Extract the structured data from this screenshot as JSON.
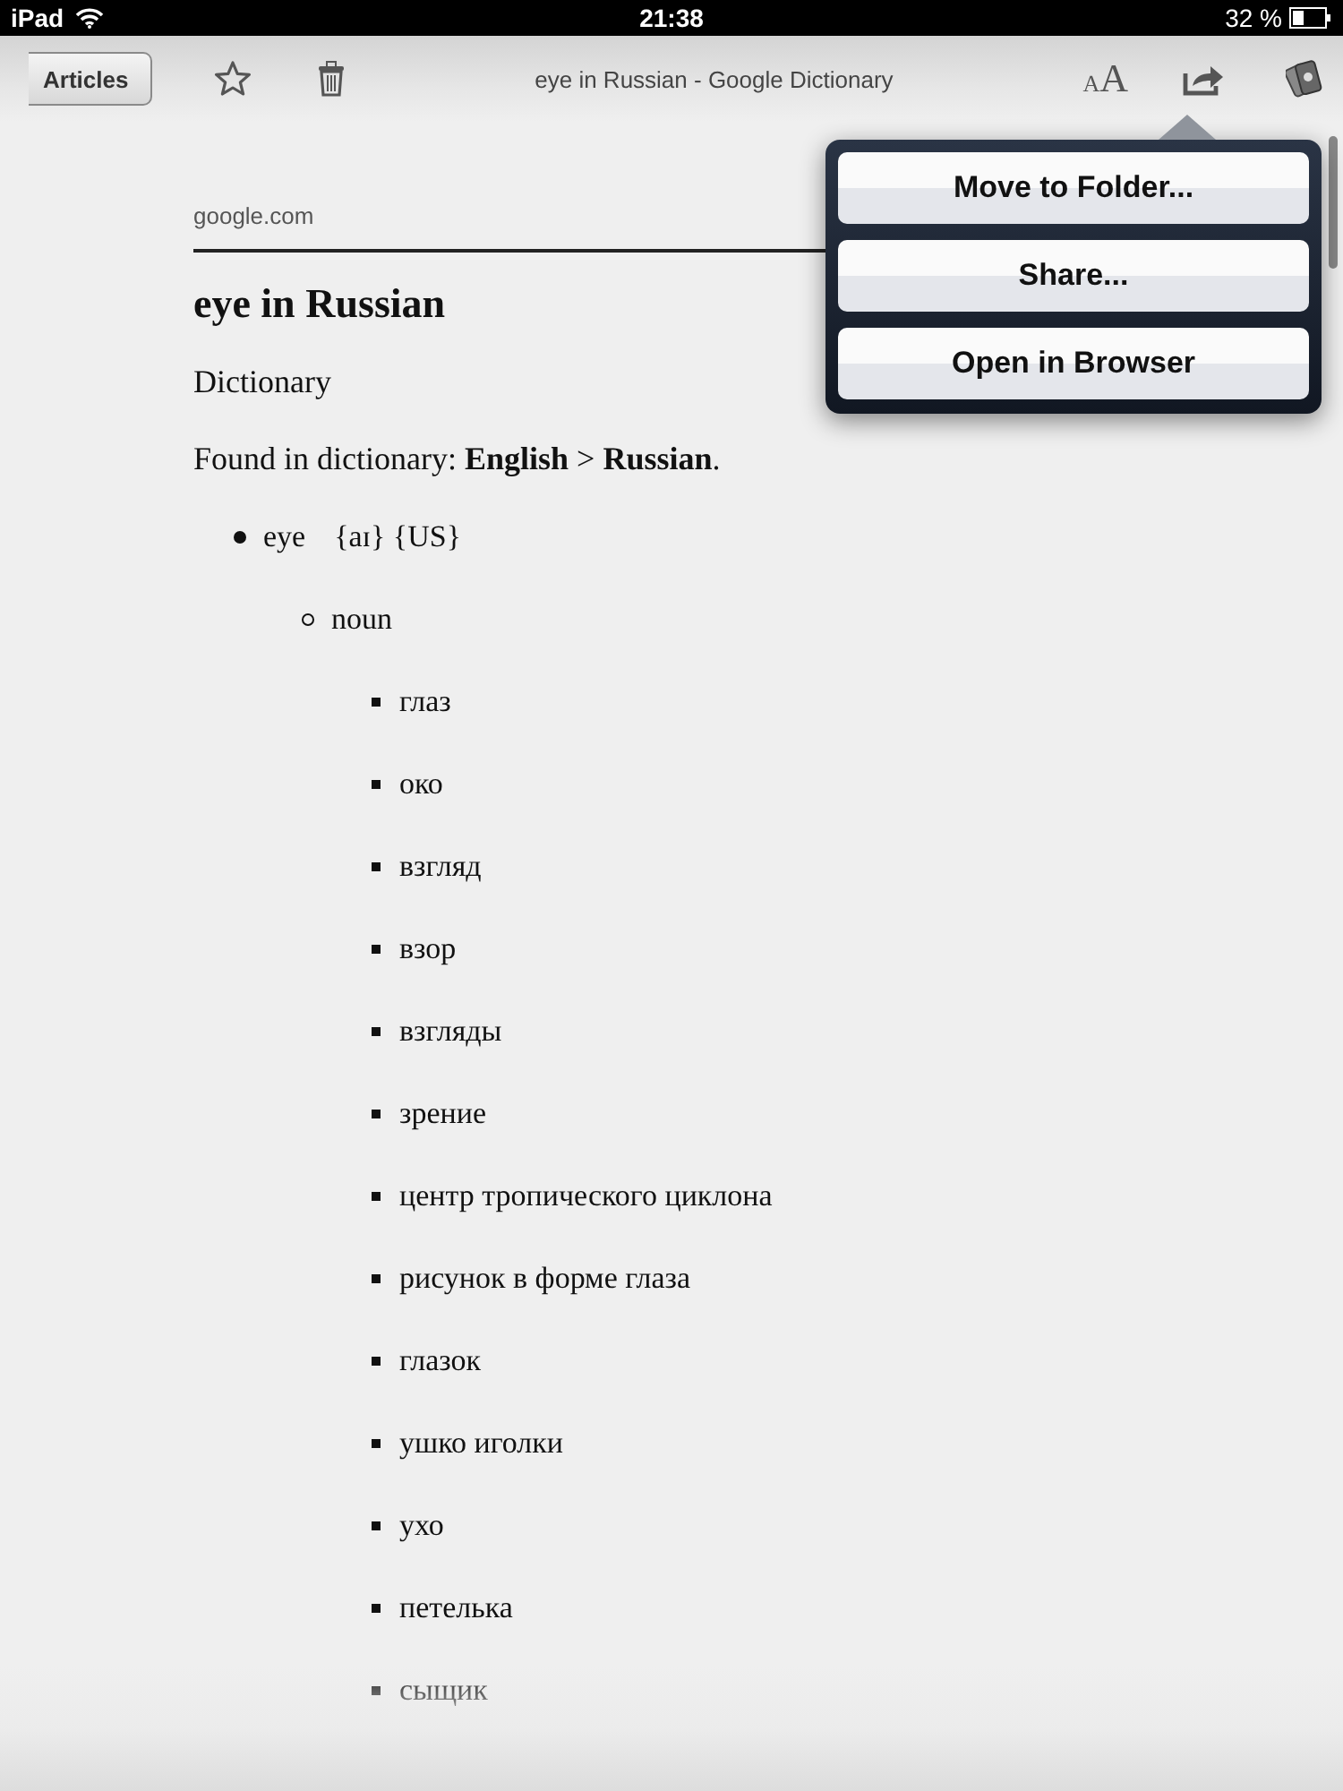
{
  "status_bar": {
    "device": "iPad",
    "time": "21:38",
    "battery": "32 %"
  },
  "toolbar": {
    "back_button": "Articles",
    "title": "eye in Russian - Google Dictionary",
    "font_size_button": {
      "small": "A",
      "large": "A"
    }
  },
  "popover": {
    "items": [
      "Move to Folder...",
      "Share...",
      "Open in Browser"
    ]
  },
  "article": {
    "source": "google.com",
    "title": "eye in Russian",
    "section": "Dictionary",
    "found_line": "Found in dictionary: **English** > **Russian**.",
    "entries": [
      {
        "term": "eye",
        "pronunciation": "{aɪ} {US}",
        "children": [
          {
            "label": "noun",
            "children": [
              {
                "label": "глаз"
              },
              {
                "label": "око"
              },
              {
                "label": "взгляд"
              },
              {
                "label": "взор"
              },
              {
                "label": "взгляды"
              },
              {
                "label": "зрение"
              },
              {
                "label": "центр тропического циклона"
              },
              {
                "label": "рисунок в форме глаза"
              },
              {
                "label": "глазок"
              },
              {
                "label": "ушко иголки"
              },
              {
                "label": "ухо"
              },
              {
                "label": "петелька"
              },
              {
                "label": "сыщик"
              }
            ]
          }
        ]
      }
    ]
  }
}
